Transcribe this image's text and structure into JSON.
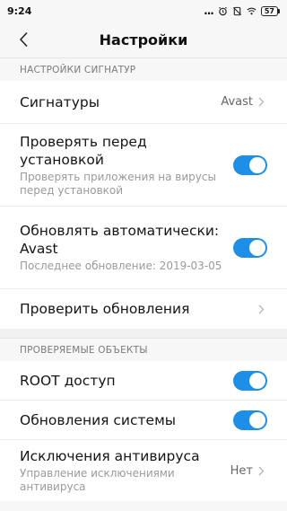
{
  "status": {
    "time": "9:24",
    "dots": "...",
    "battery": "57"
  },
  "header": {
    "title": "Настройки"
  },
  "sections": [
    {
      "header": "НАСТРОЙКИ СИГНАТУР"
    },
    {
      "header": "ПРОВЕРЯЕМЫЕ ОБЪЕКТЫ"
    }
  ],
  "rows": {
    "signatures": {
      "title": "Сигнатуры",
      "value": "Avast"
    },
    "scan_before_install": {
      "title": "Проверять перед установкой",
      "subtitle": "Проверять приложения на вирусы перед установкой",
      "enabled": true
    },
    "auto_update": {
      "title": "Обновлять автоматически: Avast",
      "subtitle": "Последнее обновление: 2019-03-05",
      "enabled": true
    },
    "check_updates": {
      "title": "Проверить обновления"
    },
    "root_access": {
      "title": "ROOT доступ",
      "enabled": true
    },
    "system_updates": {
      "title": "Обновления системы",
      "enabled": true
    },
    "exclusions": {
      "title": "Исключения антивируса",
      "subtitle": "Управление исключениями антивируса",
      "value": "Нет"
    }
  },
  "colors": {
    "accent": "#1e8fe8",
    "background": "#f7f7f7"
  }
}
